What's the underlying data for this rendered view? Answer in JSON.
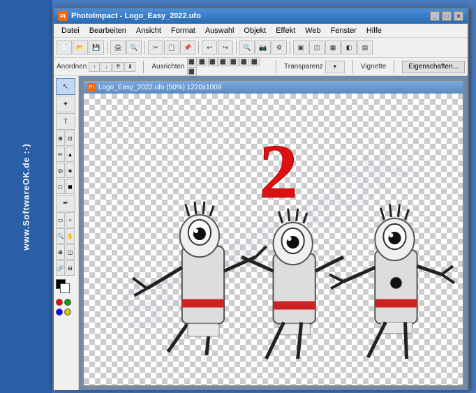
{
  "app": {
    "title": "PhotoImpact - Logo_Easy_2022.ufo",
    "icon": "PI",
    "left_sidebar_text": "www.SoftwareOK.de :-)"
  },
  "menu": {
    "items": [
      "Datei",
      "Bearbeiten",
      "Ansicht",
      "Format",
      "Auswahl",
      "Objekt",
      "Effekt",
      "Web",
      "Fenster",
      "Hilfe"
    ]
  },
  "properties_bar": {
    "arrange_label": "Anordnen",
    "align_label": "Ausrichten",
    "transparency_label": "Transparenz",
    "vignette_label": "Vignette",
    "properties_btn": "Eigenschaften..."
  },
  "canvas": {
    "title": "Logo_Easy_2022.ufo (50%) 1220x1009"
  },
  "toolbar": {
    "buttons": [
      "new",
      "open",
      "save",
      "print",
      "cut",
      "copy",
      "paste",
      "undo",
      "redo",
      "zoom-in",
      "zoom-out"
    ]
  },
  "colors": {
    "primary": "#000000",
    "secondary": "#ffffff",
    "red": "#ff0000",
    "green": "#00aa00",
    "blue": "#0000ff",
    "title_bar_start": "#4a90d9",
    "title_bar_end": "#2a6ab0",
    "sidebar_bg": "#2a5fa8"
  }
}
